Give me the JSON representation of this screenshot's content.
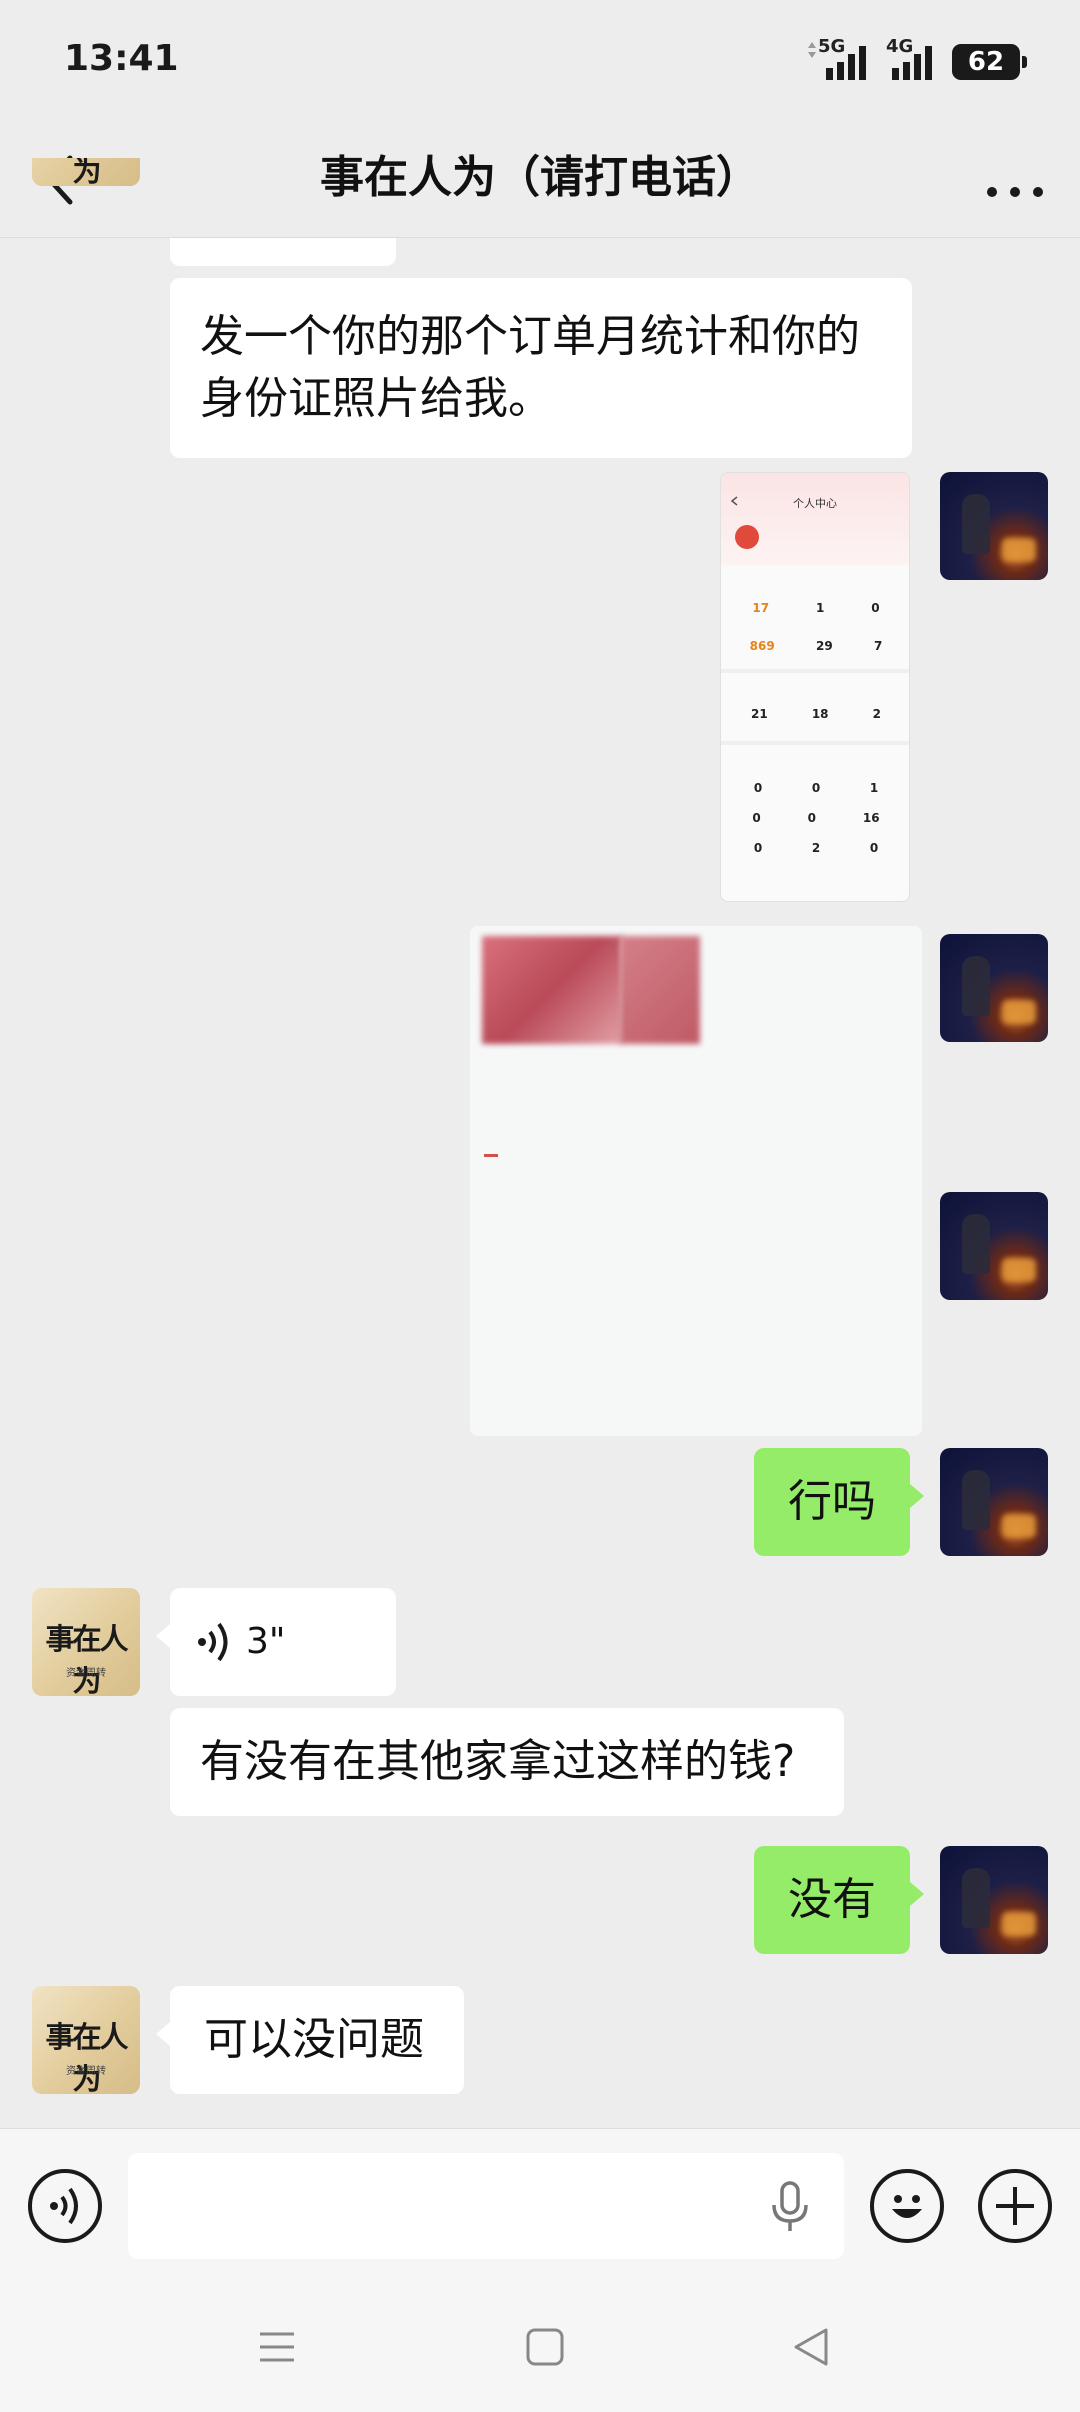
{
  "status_bar": {
    "time": "13:41",
    "signal_1": "5G",
    "signal_2": "4G",
    "battery": "62"
  },
  "header": {
    "title": "事在人为（请打电话）"
  },
  "contact": {
    "avatar_text": "事在人为",
    "avatar_sub": "资金周转"
  },
  "messages": [
    {
      "side": "in",
      "type": "text",
      "text": "发一个你的那个订单月统计和你的身份证照片给我。"
    },
    {
      "side": "out",
      "type": "image",
      "title": "个人中心",
      "stats": {
        "row1": [
          "17",
          "1",
          "0"
        ],
        "row2": [
          "869",
          "29",
          "7"
        ],
        "row3": [
          "21",
          "18",
          "2"
        ],
        "row4": [
          "0",
          "0",
          "1"
        ],
        "row5": [
          "0",
          "0",
          "16"
        ],
        "row6": [
          "0",
          "2",
          "0"
        ]
      }
    },
    {
      "side": "out",
      "type": "image_blurred"
    },
    {
      "side": "out",
      "type": "text",
      "text": "行吗"
    },
    {
      "side": "in",
      "type": "voice",
      "duration": "3\""
    },
    {
      "side": "in",
      "type": "text",
      "text": "有没有在其他家拿过这样的钱?"
    },
    {
      "side": "out",
      "type": "text",
      "text": "没有"
    },
    {
      "side": "in",
      "type": "text",
      "text": "可以没问题"
    }
  ],
  "input": {
    "value": "",
    "placeholder": ""
  },
  "colors": {
    "background": "#ededed",
    "outgoing_bubble": "#95ec69",
    "incoming_bubble": "#ffffff"
  },
  "icons": {
    "back": "back-arrow-icon",
    "more": "more-dots-icon",
    "voice_input": "voice-toggle-icon",
    "mic": "microphone-icon",
    "emoji": "emoji-icon",
    "plus": "plus-icon"
  }
}
